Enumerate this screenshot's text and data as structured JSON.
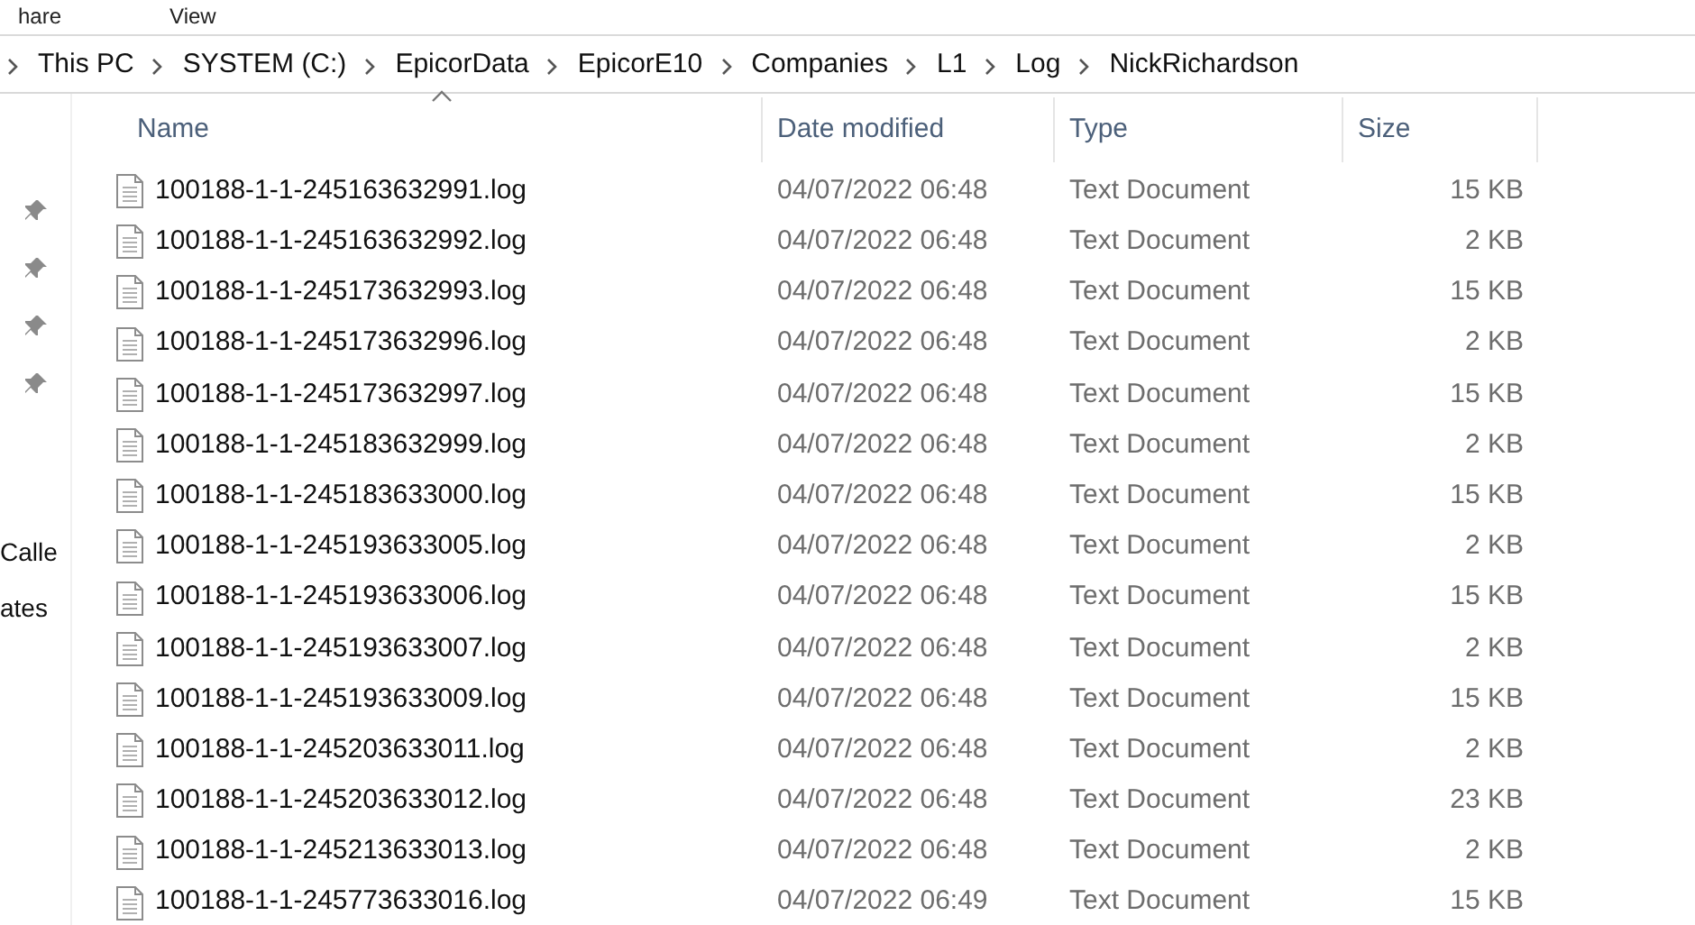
{
  "ribbon_tabs": [
    "hare",
    "View"
  ],
  "breadcrumb": [
    "This PC",
    "SYSTEM (C:)",
    "EpicorData",
    "EpicorE10",
    "Companies",
    "L1",
    "Log",
    "NickRichardson"
  ],
  "nav_pane": {
    "pinned_count_items": [
      {
        "pinned": true
      },
      {
        "pinned": true
      },
      {
        "pinned": true
      },
      {
        "pinned": true
      }
    ],
    "labels": [
      "Calle",
      "ates"
    ]
  },
  "columns": [
    {
      "label": "Name",
      "sorted": true
    },
    {
      "label": "Date modified",
      "sorted": false
    },
    {
      "label": "Type",
      "sorted": false
    },
    {
      "label": "Size",
      "sorted": false
    }
  ],
  "rows": [
    {
      "name": "100188-1-1-245163632991.log",
      "date": "04/07/2022 06:48",
      "type": "Text Document",
      "size": "15 KB"
    },
    {
      "name": "100188-1-1-245163632992.log",
      "date": "04/07/2022 06:48",
      "type": "Text Document",
      "size": "2 KB"
    },
    {
      "name": "100188-1-1-245173632993.log",
      "date": "04/07/2022 06:48",
      "type": "Text Document",
      "size": "15 KB"
    },
    {
      "name": "100188-1-1-245173632996.log",
      "date": "04/07/2022 06:48",
      "type": "Text Document",
      "size": "2 KB"
    },
    {
      "name": "100188-1-1-245173632997.log",
      "date": "04/07/2022 06:48",
      "type": "Text Document",
      "size": "15 KB"
    },
    {
      "name": "100188-1-1-245183632999.log",
      "date": "04/07/2022 06:48",
      "type": "Text Document",
      "size": "2 KB"
    },
    {
      "name": "100188-1-1-245183633000.log",
      "date": "04/07/2022 06:48",
      "type": "Text Document",
      "size": "15 KB"
    },
    {
      "name": "100188-1-1-245193633005.log",
      "date": "04/07/2022 06:48",
      "type": "Text Document",
      "size": "2 KB"
    },
    {
      "name": "100188-1-1-245193633006.log",
      "date": "04/07/2022 06:48",
      "type": "Text Document",
      "size": "15 KB"
    },
    {
      "name": "100188-1-1-245193633007.log",
      "date": "04/07/2022 06:48",
      "type": "Text Document",
      "size": "2 KB"
    },
    {
      "name": "100188-1-1-245193633009.log",
      "date": "04/07/2022 06:48",
      "type": "Text Document",
      "size": "15 KB"
    },
    {
      "name": "100188-1-1-245203633011.log",
      "date": "04/07/2022 06:48",
      "type": "Text Document",
      "size": "2 KB"
    },
    {
      "name": "100188-1-1-245203633012.log",
      "date": "04/07/2022 06:48",
      "type": "Text Document",
      "size": "23 KB"
    },
    {
      "name": "100188-1-1-245213633013.log",
      "date": "04/07/2022 06:48",
      "type": "Text Document",
      "size": "2 KB"
    },
    {
      "name": "100188-1-1-245773633016.log",
      "date": "04/07/2022 06:49",
      "type": "Text Document",
      "size": "15 KB"
    }
  ]
}
